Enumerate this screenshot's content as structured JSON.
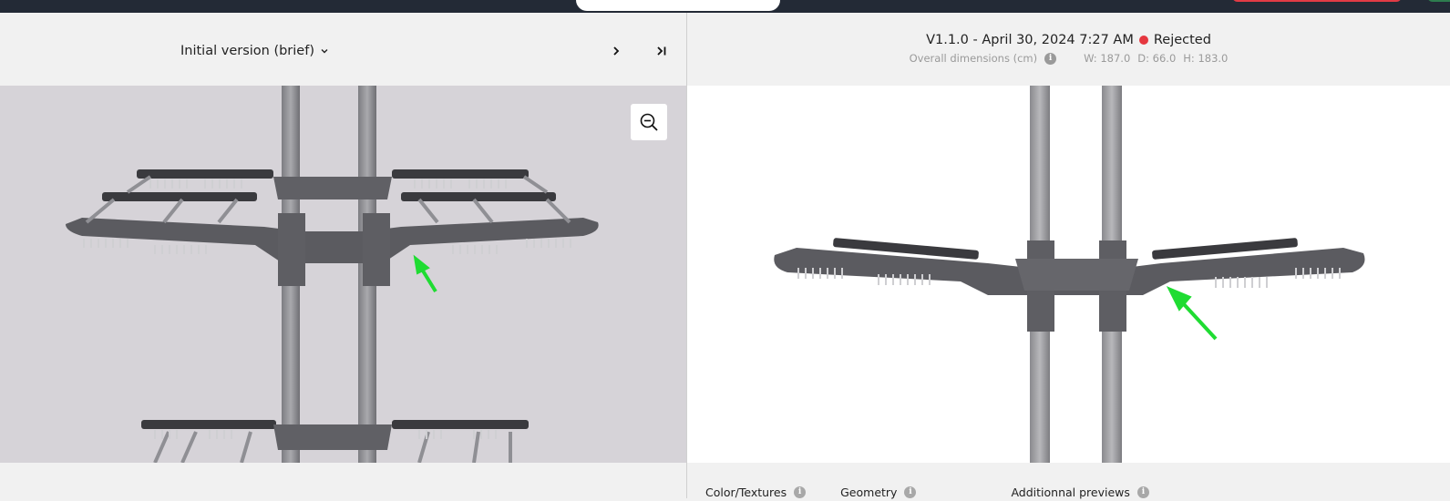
{
  "left_panel": {
    "version_selector": {
      "label": "Initial version (brief)",
      "icon": "chevron-down-icon"
    },
    "nav": {
      "next_icon": "chevron-right-icon",
      "last_icon": "skip-to-end-icon"
    },
    "zoom_icon": "zoom-out-icon"
  },
  "right_panel": {
    "version_label": "V1.1.0 - April 30, 2024 7:27 AM",
    "status": {
      "label": "Rejected",
      "color": "#e5373f"
    },
    "dimensions": {
      "label": "Overall dimensions (cm)",
      "w": "W: 187.0",
      "d": "D: 66.0",
      "h": "H: 183.0"
    },
    "tabs": [
      {
        "label": "Color/Textures"
      },
      {
        "label": "Geometry"
      },
      {
        "label": "Additionnal previews"
      }
    ]
  },
  "colors": {
    "annotation_arrow": "#1fdc32",
    "topbar": "#232a36",
    "rejected_button": "#e23b45"
  }
}
